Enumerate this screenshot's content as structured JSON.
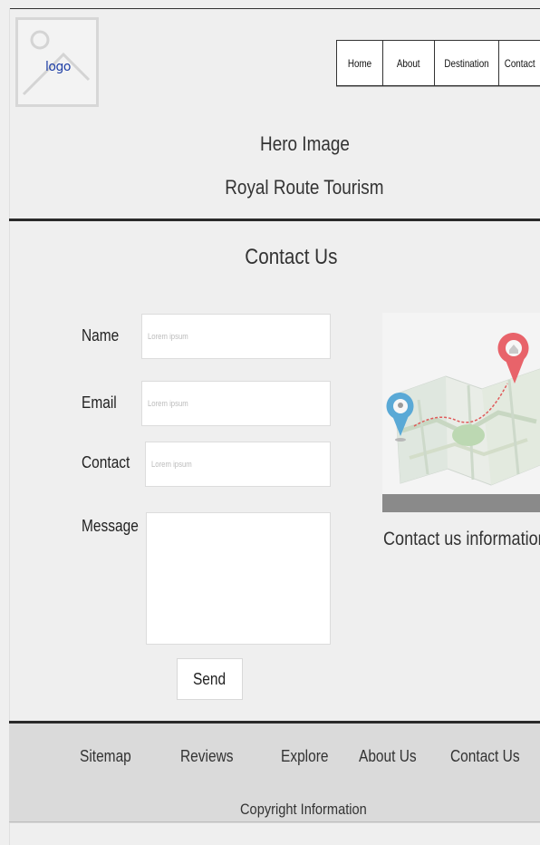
{
  "header": {
    "logo_text": "logo",
    "nav": [
      "Home",
      "About",
      "Destination",
      "Contact"
    ]
  },
  "hero": {
    "line1": "Hero Image",
    "line2": "Royal Route Tourism"
  },
  "contact": {
    "title": "Contact Us",
    "fields": {
      "name_label": "Name",
      "name_placeholder": "Lorem ipsum",
      "email_label": "Email",
      "email_placeholder": "Lorem ipsum",
      "contact_label": "Contact",
      "contact_placeholder": "Lorem ipsum",
      "message_label": "Message"
    },
    "send_label": "Send",
    "info_text": "Contact us information"
  },
  "footer": {
    "links": [
      "Sitemap",
      "Reviews",
      "Explore",
      "About Us",
      "Contact Us"
    ],
    "copyright": "Copyright Information"
  },
  "colors": {
    "background": "#efefef",
    "footer_bg": "#dadada",
    "logo_text": "#1f3fa6",
    "map_pin_red": "#e8636a",
    "map_pin_blue": "#5aa9d6"
  }
}
